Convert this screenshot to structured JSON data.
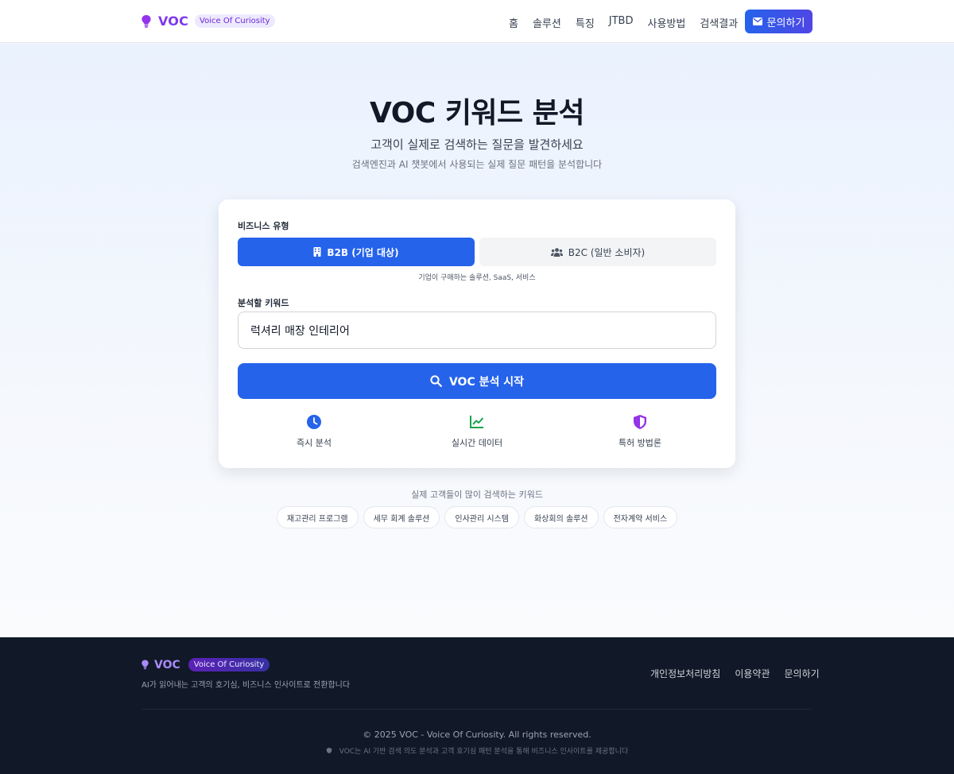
{
  "header": {
    "logo_text": "VOC",
    "logo_badge": "Voice Of Curiosity",
    "nav": [
      "홈",
      "솔루션",
      "특징",
      "JTBD",
      "사용방법",
      "검색결과"
    ],
    "contact_label": "문의하기"
  },
  "hero": {
    "title": "VOC 키워드 분석",
    "subtitle": "고객이 실제로 검색하는 질문을 발견하세요",
    "description": "검색엔진과 AI 챗봇에서 사용되는 실제 질문 패턴을 분석합니다"
  },
  "form": {
    "business_type_label": "비즈니스 유형",
    "b2b_label": "B2B (기업 대상)",
    "b2c_label": "B2C (일반 소비자)",
    "selected_type": "B2B",
    "type_hint": "기업이 구매하는 솔루션, SaaS, 서비스",
    "keyword_label": "분석할 키워드",
    "keyword_value": "럭셔리 매장 인테리어",
    "analyze_label": "VOC 분석 시작"
  },
  "features": [
    {
      "icon": "clock-icon",
      "label": "즉시 분석",
      "color": "#2563eb"
    },
    {
      "icon": "chart-line-icon",
      "label": "실시간 데이터",
      "color": "#16a34a"
    },
    {
      "icon": "shield-icon",
      "label": "특허 방법론",
      "color": "#9333ea"
    }
  ],
  "popular": {
    "title": "실제 고객들이 많이 검색하는 키워드",
    "chips": [
      "재고관리 프로그램",
      "세무 회계 솔루션",
      "인사관리 시스템",
      "화상회의 솔루션",
      "전자계약 서비스"
    ]
  },
  "footer": {
    "logo_text": "VOC",
    "logo_badge": "Voice Of Curiosity",
    "tagline": "AI가 읽어내는 고객의 호기심, 비즈니스 인사이트로 전환합니다",
    "links": [
      "개인정보처리방침",
      "이용약관",
      "문의하기"
    ],
    "copyright": "© 2025 VOC - Voice Of Curiosity. All rights reserved.",
    "note": "VOC는 AI 기반 검색 의도 분석과 고객 호기심 패턴 분석을 통해 비즈니스 인사이트를 제공합니다"
  },
  "colors": {
    "primary": "#2563eb",
    "brand_purple": "#7c3aed",
    "footer_bg": "#111827"
  }
}
